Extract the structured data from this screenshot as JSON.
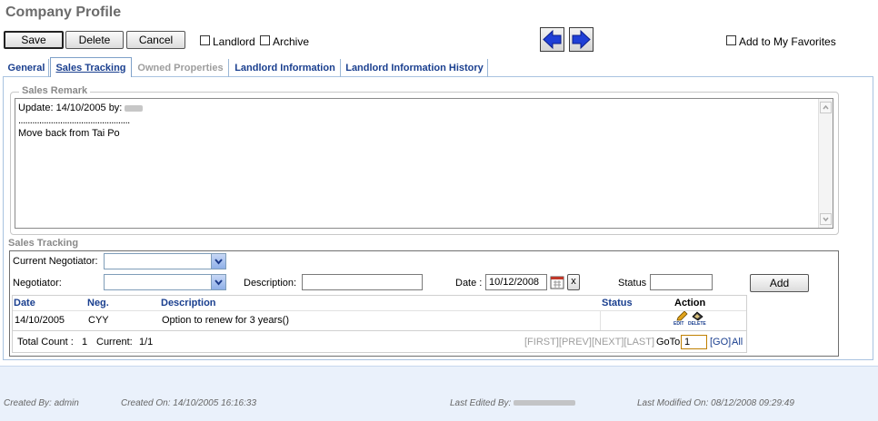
{
  "page": {
    "title": "Company Profile"
  },
  "toolbar": {
    "save_label": "Save",
    "delete_label": "Delete",
    "cancel_label": "Cancel",
    "landlord_label": "Landlord",
    "archive_label": "Archive",
    "favorites_label": "Add to My Favorites",
    "prev_icon": "arrow-left-icon",
    "next_icon": "arrow-right-icon"
  },
  "tabs": [
    {
      "label": "General",
      "state": "normal"
    },
    {
      "label": "Sales Tracking",
      "state": "active"
    },
    {
      "label": "Owned Properties",
      "state": "disabled"
    },
    {
      "label": "Landlord Information",
      "state": "normal"
    },
    {
      "label": "Landlord Information History",
      "state": "normal"
    }
  ],
  "sales_remark": {
    "legend": "Sales Remark",
    "line1": "Update: 14/10/2005 by:",
    "line2": "................................................",
    "line3": "Move back from Tai Po"
  },
  "sales_tracking": {
    "legend": "Sales Tracking",
    "current_negotiator_label": "Current Negotiator:",
    "current_negotiator_value": "",
    "negotiator_label": "Negotiator:",
    "negotiator_value": "",
    "description_label": "Description:",
    "description_value": "",
    "date_label": "Date :",
    "date_value": "10/12/2008",
    "clear_label": "x",
    "status_label": "Status",
    "status_value": "",
    "add_label": "Add",
    "columns": [
      "Date",
      "Neg.",
      "Description",
      "Status",
      "Action"
    ],
    "rows": [
      {
        "date": "14/10/2005",
        "neg": "CYY",
        "description": "Option to renew for 3 years()",
        "status": "",
        "edit": "EDIT",
        "delete": "DELETE"
      }
    ],
    "total_count_label": "Total Count :",
    "total_count": "1",
    "current_label": "Current:",
    "current_value": "1/1",
    "pager": "[FIRST][PREV][NEXT][LAST]",
    "goto_label": "GoTo",
    "goto_value": "1",
    "go_label": "[GO]",
    "all_label": "All"
  },
  "footer": {
    "created_by": "Created By: admin",
    "created_on": "Created On: 14/10/2005 16:16:33",
    "last_edited_by": "Last Edited By:",
    "last_modified_on": "Last Modified On: 08/12/2008 09:29:49"
  },
  "colors": {
    "link": "#1a3f8f",
    "panel_border": "#a9c3e0",
    "footer_bg": "#eaf1fb",
    "arrow_blue": "#1f3fd6"
  }
}
